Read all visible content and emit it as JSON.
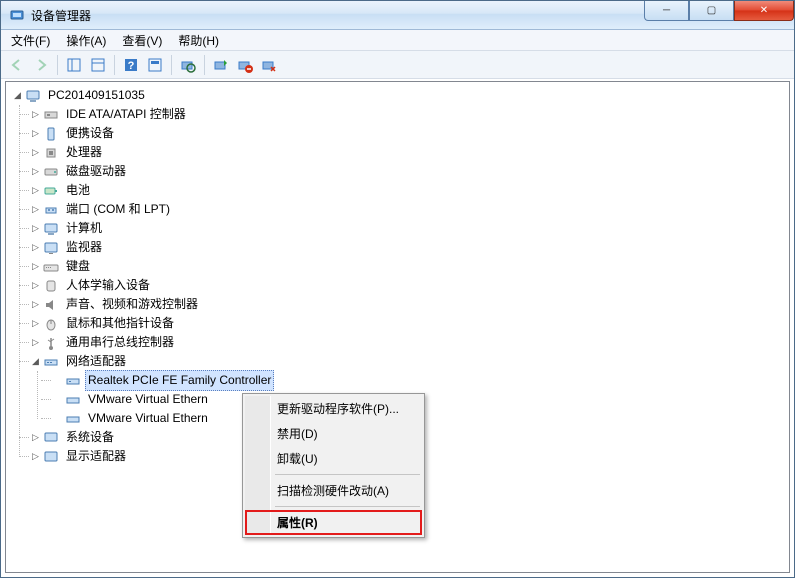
{
  "window": {
    "title": "设备管理器"
  },
  "menu": {
    "file": "文件(F)",
    "action": "操作(A)",
    "view": "查看(V)",
    "help": "帮助(H)"
  },
  "tree": {
    "root": "PC201409151035",
    "cat_ide": "IDE ATA/ATAPI 控制器",
    "cat_portable": "便携设备",
    "cat_cpu": "处理器",
    "cat_disk": "磁盘驱动器",
    "cat_battery": "电池",
    "cat_ports": "端口 (COM 和 LPT)",
    "cat_computer": "计算机",
    "cat_monitor": "监视器",
    "cat_keyboard": "键盘",
    "cat_hid": "人体学输入设备",
    "cat_sound": "声音、视频和游戏控制器",
    "cat_mouse": "鼠标和其他指针设备",
    "cat_usb": "通用串行总线控制器",
    "cat_network": "网络适配器",
    "net_realtek": "Realtek PCIe FE Family Controller",
    "net_vmware1": "VMware Virtual Ethern",
    "net_vmware2": "VMware Virtual Ethern",
    "cat_system": "系统设备",
    "cat_display": "显示适配器"
  },
  "context_menu": {
    "update_driver": "更新驱动程序软件(P)...",
    "disable": "禁用(D)",
    "uninstall": "卸载(U)",
    "scan_hw": "扫描检测硬件改动(A)",
    "properties": "属性(R)"
  }
}
